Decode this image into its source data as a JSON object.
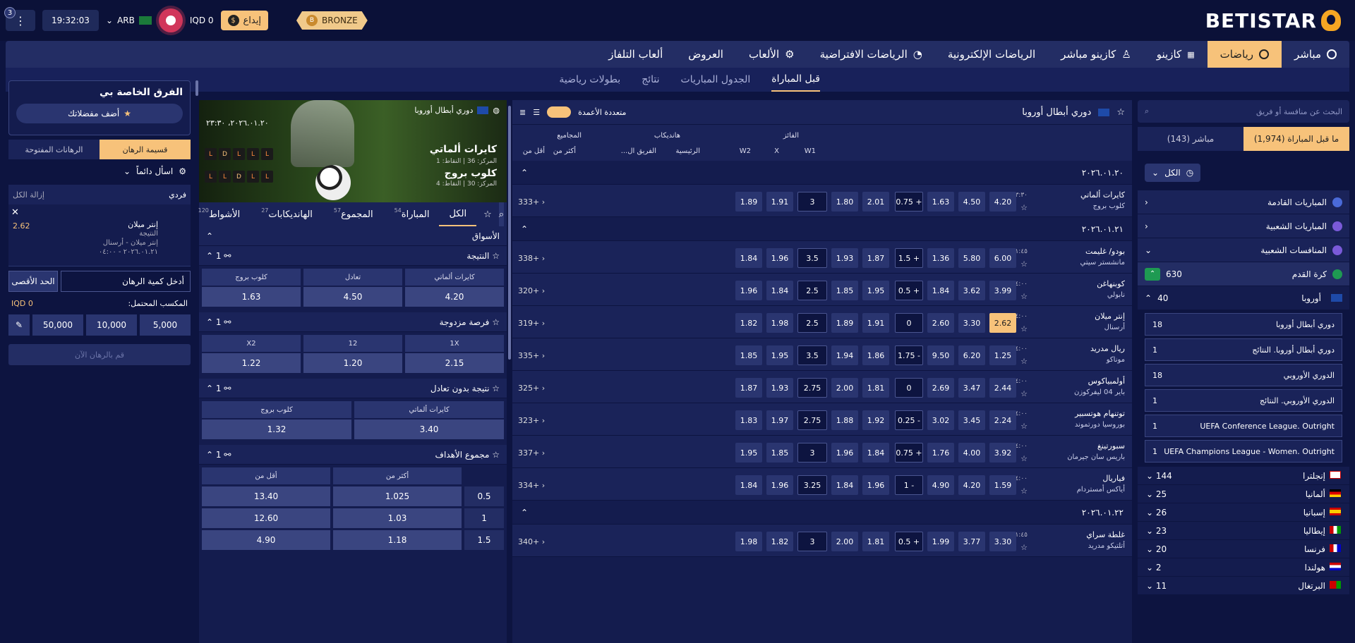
{
  "header": {
    "logo": "BETISTAR",
    "notif_count": "3",
    "clock": "19:32:03",
    "lang": "ARB",
    "balance": "IQD 0",
    "deposit": "إيداع",
    "tier": "BRONZE",
    "tier_letter": "B"
  },
  "nav": {
    "items": [
      "مباشر",
      "رياضات",
      "كازينو",
      "كازينو مباشر",
      "الرياضات الإلكترونية",
      "الرياضات الافتراضية",
      "الألعاب",
      "العروض",
      "ألعاب التلفاز"
    ]
  },
  "subnav": {
    "items": [
      "قبل المباراة",
      "الجدول المباريات",
      "نتائج",
      "بطولات رياضية"
    ]
  },
  "sidebar": {
    "search_placeholder": "البحث عن منافسة أو فريق",
    "tab_live": "مباشر (143)",
    "tab_prematch": "ما قبل المباراة (1,974)",
    "all": "الكل",
    "menu": [
      "المباريات القادمة",
      "المباريات الشعبية",
      "المنافسات الشعبية"
    ],
    "football": {
      "label": "كرة القدم",
      "count": "630"
    },
    "europe": {
      "label": "أوروبا",
      "count": "40"
    },
    "leagues": [
      {
        "name": "دوري أبطال أوروبا",
        "count": "18"
      },
      {
        "name": "دوري أبطال أوروبا. النتائج",
        "count": "1"
      },
      {
        "name": "الدوري الأوروبي",
        "count": "18"
      },
      {
        "name": "الدوري الأوروبي. النتائج",
        "count": "1"
      },
      {
        "name": "UEFA Conference League. Outright",
        "count": "1"
      },
      {
        "name": "UEFA Champions League - Women. Outright",
        "count": "1"
      }
    ],
    "countries": [
      {
        "name": "إنجلترا",
        "count": "144"
      },
      {
        "name": "ألمانيا",
        "count": "25"
      },
      {
        "name": "إسبانيا",
        "count": "26"
      },
      {
        "name": "إيطاليا",
        "count": "23"
      },
      {
        "name": "فرنسا",
        "count": "20"
      },
      {
        "name": "هولندا",
        "count": "2"
      },
      {
        "name": "البرتغال",
        "count": "11"
      }
    ]
  },
  "center": {
    "league": "دوري أبطال أوروبا",
    "multi_col": "متعددة الأعمدة",
    "groups": {
      "winner": "الفائز",
      "handicap": "هانديكاب",
      "totals": "المجاميع"
    },
    "cols": {
      "w1": "W1",
      "x": "X",
      "w2": "W2",
      "main": "الرئيسية",
      "team": "الفريق ال...",
      "over": "أكثر من",
      "under": "أقل من"
    },
    "dates": [
      "٢٠٢٦.٠١.٢٠",
      "٢٠٢٦.٠١.٢١",
      "٢٠٢٦.٠١.٢٢"
    ],
    "matches": [
      {
        "t1": "كايرات ألماتي",
        "t2": "كلوب بروج",
        "time": "٢٣:٣٠",
        "w1": "4.20",
        "x": "4.50",
        "w2": "1.63",
        "hl": "+ 0.75",
        "h1": "2.01",
        "h2": "1.80",
        "tl": "3",
        "o": "1.91",
        "u": "1.89",
        "more": "+333"
      },
      {
        "t1": "بودو/ غليمت",
        "t2": "مانشستر سيتي",
        "time": "٠١:٤٥",
        "w1": "6.00",
        "x": "5.80",
        "w2": "1.36",
        "hl": "+ 1.5",
        "h1": "1.87",
        "h2": "1.93",
        "tl": "3.5",
        "o": "1.96",
        "u": "1.84",
        "more": "+338"
      },
      {
        "t1": "كوبنهاغن",
        "t2": "نابولي",
        "time": "٠٤:٠٠",
        "w1": "3.99",
        "x": "3.62",
        "w2": "1.84",
        "hl": "+ 0.5",
        "h1": "1.95",
        "h2": "1.85",
        "tl": "2.5",
        "o": "1.84",
        "u": "1.96",
        "more": "+320"
      },
      {
        "t1": "إنتر ميلان",
        "t2": "أرسنال",
        "time": "٠٤:٠٠",
        "w1": "2.62",
        "x": "3.30",
        "w2": "2.60",
        "hl": "0",
        "h1": "1.91",
        "h2": "1.89",
        "tl": "2.5",
        "o": "1.98",
        "u": "1.82",
        "more": "+319",
        "sel": true
      },
      {
        "t1": "ريال مدريد",
        "t2": "موناكو",
        "time": "٠٤:٠٠",
        "w1": "1.25",
        "x": "6.20",
        "w2": "9.50",
        "hl": "- 1.75",
        "h1": "1.86",
        "h2": "1.94",
        "tl": "3.5",
        "o": "1.95",
        "u": "1.85",
        "more": "+335"
      },
      {
        "t1": "أولمبياكوس",
        "t2": "باير 04 ليفركوزن",
        "time": "٠٤:٠٠",
        "w1": "2.44",
        "x": "3.47",
        "w2": "2.69",
        "hl": "0",
        "h1": "1.81",
        "h2": "2.00",
        "tl": "2.75",
        "o": "1.93",
        "u": "1.87",
        "more": "+325"
      },
      {
        "t1": "توتنهام هوتسبير",
        "t2": "بوروسيا دورتموند",
        "time": "٠٤:٠٠",
        "w1": "2.24",
        "x": "3.45",
        "w2": "3.02",
        "hl": "- 0.25",
        "h1": "1.92",
        "h2": "1.88",
        "tl": "2.75",
        "o": "1.97",
        "u": "1.83",
        "more": "+323"
      },
      {
        "t1": "سبورتينغ",
        "t2": "باريس سان جيرمان",
        "time": "٠٤:٠٠",
        "w1": "3.92",
        "x": "4.00",
        "w2": "1.76",
        "hl": "+ 0.75",
        "h1": "1.84",
        "h2": "1.96",
        "tl": "3",
        "o": "1.85",
        "u": "1.95",
        "more": "+337"
      },
      {
        "t1": "فياريال",
        "t2": "أياكس أمستردام",
        "time": "٠٤:٠٠",
        "w1": "1.59",
        "x": "4.20",
        "w2": "4.90",
        "hl": "- 1",
        "h1": "1.96",
        "h2": "1.84",
        "tl": "3.25",
        "o": "1.96",
        "u": "1.84",
        "more": "+334"
      },
      {
        "t1": "غلطة سراي",
        "t2": "أتلتيكو مدريد",
        "time": "٠١:٤٥",
        "w1": "3.30",
        "x": "3.77",
        "w2": "1.99",
        "hl": "+ 0.5",
        "h1": "1.81",
        "h2": "2.00",
        "tl": "3",
        "o": "1.82",
        "u": "1.98",
        "more": "+340"
      }
    ]
  },
  "event": {
    "league": "دوري أبطال أوروبا",
    "date": "٢٠٢٦.٠١.٢٠، ٢٣:٣٠",
    "t1": "كايرات ألماتي",
    "t1_stats": "المركز: 36 | النقاط: 1",
    "t2": "كلوب بروج",
    "t2_stats": "المركز: 30 | النقاط: 4",
    "form1": [
      "L",
      "L",
      "L",
      "D",
      "L"
    ],
    "form2": [
      "L",
      "L",
      "D",
      "L",
      "L"
    ],
    "tabs": [
      {
        "l": "الكل"
      },
      {
        "l": "المباراة",
        "n": "54"
      },
      {
        "l": "المجموع",
        "n": "57"
      },
      {
        "l": "الهانديكابات",
        "n": "27"
      },
      {
        "l": "الأشواط",
        "n": "120"
      }
    ],
    "markets_title": "الأسواق",
    "m_result": {
      "title": "النتيجة",
      "count": "1",
      "labels": [
        "كايرات ألماتي",
        "تعادل",
        "كلوب بروج"
      ],
      "vals": [
        "4.20",
        "4.50",
        "1.63"
      ]
    },
    "m_dc": {
      "title": "فرصة مزدوجة",
      "count": "1",
      "labels": [
        "1X",
        "12",
        "X2"
      ],
      "vals": [
        "2.15",
        "1.20",
        "1.22"
      ]
    },
    "m_dnb": {
      "title": "نتيجة بدون تعادل",
      "count": "1",
      "labels": [
        "كايرات ألماتي",
        "كلوب بروج"
      ],
      "vals": [
        "3.40",
        "1.32"
      ]
    },
    "m_goals": {
      "title": "مجموع الأهداف",
      "count": "1",
      "labels": [
        "أكثر من",
        "أقل من"
      ],
      "rows": [
        [
          "0.5",
          "1.025",
          "13.40"
        ],
        [
          "1",
          "1.03",
          "12.60"
        ],
        [
          "1.5",
          "1.18",
          "4.90"
        ]
      ]
    }
  },
  "slip": {
    "fav_title": "الفرق الخاصة بي",
    "fav_btn": "أضف مفضلاتك",
    "tab_slip": "قسيمة الرهان",
    "tab_open": "الرهانات المفتوحة",
    "always_ask": "اسأل دائماً",
    "single": "فردي",
    "remove_all": "إزالة الكل",
    "pick_team": "إنتر ميلان",
    "pick_market": "النتيجة",
    "pick_match": "إنتر ميلان - أرسنال",
    "pick_date": "٢٠٢٦.٠١.٢١ - ٠٤:٠٠",
    "pick_odd": "2.62",
    "stake_placeholder": "أدخل كمية الرهان",
    "max": "الحد الأقصى",
    "potential": "المكسب المحتمل:",
    "potential_val": "IQD 0",
    "quick": [
      "5,000",
      "10,000",
      "50,000"
    ],
    "place": "قم بالرهان الآن"
  }
}
